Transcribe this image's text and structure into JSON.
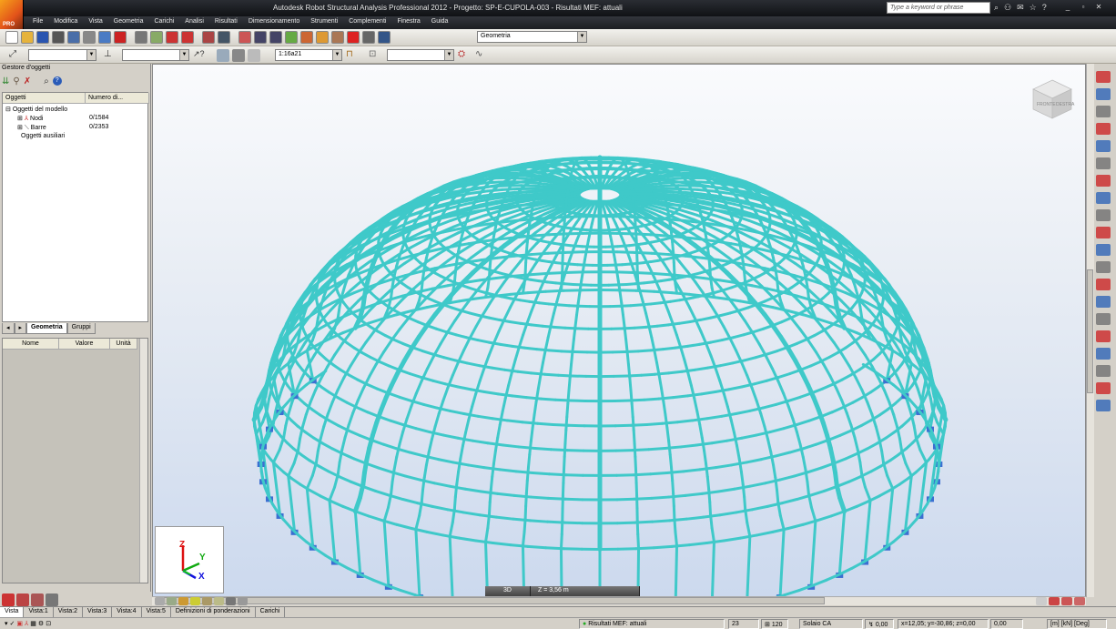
{
  "window": {
    "title": "Autodesk Robot Structural Analysis Professional 2012 - Progetto: SP-E-CUPOLA-003 - Risultati MEF: attuali",
    "logo_text": "PRO"
  },
  "search": {
    "placeholder": "Type a keyword or phrase"
  },
  "menu": [
    "File",
    "Modifica",
    "Vista",
    "Geometria",
    "Carichi",
    "Analisi",
    "Risultati",
    "Dimensionamento",
    "Strumenti",
    "Complementi",
    "Finestra",
    "Guida"
  ],
  "toolbar1": {
    "layout_combo": "Geometria"
  },
  "toolbar2": {
    "combo1": "",
    "combo2": "",
    "section_combo": "1:16a21",
    "combo4": ""
  },
  "object_manager": {
    "title": "Gestore d'oggetti",
    "col_objects": "Oggetti",
    "col_number": "Numero di...",
    "tree": [
      {
        "label": "Oggetti del modello",
        "count": ""
      },
      {
        "label": "Nodi",
        "count": "0/1584"
      },
      {
        "label": "Barre",
        "count": "0/2353"
      },
      {
        "label": "Oggetti ausiliari",
        "count": ""
      }
    ],
    "tabs": [
      "Geometria",
      "Gruppi"
    ]
  },
  "properties": {
    "col_name": "Nome",
    "col_value": "Valore",
    "col_unit": "Unità"
  },
  "viewport": {
    "view_mode": "3D",
    "z_level": "Z = 3,56 m",
    "axes": {
      "z": "Z",
      "y": "Y",
      "x": "X"
    },
    "viewcube": {
      "front": "FRONTE",
      "right": "DESTRA"
    },
    "structure_color": "#3fc9c9",
    "support_color": "#3b6fd1"
  },
  "view_tabs": [
    "Vista",
    "Vista:1",
    "Vista:2",
    "Vista:3",
    "Vista:4",
    "Vista:5",
    "Definizioni di ponderazioni",
    "Carichi"
  ],
  "statusbar": {
    "results": "Risultati MEF: attuali",
    "field1": "23",
    "field2": "120",
    "section": "Solaio CA",
    "value1": "0,00",
    "coords": "x=12,05; y=-30,86; z=0,00",
    "value2": "0,00",
    "units": "[m] [kN] [Deg]"
  }
}
